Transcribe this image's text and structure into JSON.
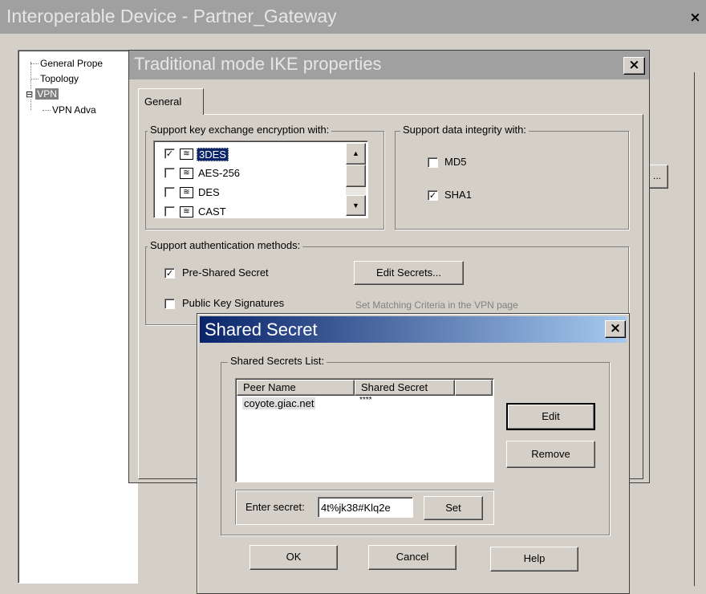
{
  "main_window": {
    "title": "Interoperable Device - Partner_Gateway",
    "tree": [
      {
        "label": "General Prope",
        "level": 0
      },
      {
        "label": "Topology",
        "level": 0
      },
      {
        "label": "VPN",
        "level": 0,
        "expander": "⊟",
        "selected": true
      },
      {
        "label": "VPN Adva",
        "level": 1
      }
    ],
    "partial_button_label": "..."
  },
  "ike_dialog": {
    "title": "Traditional mode IKE properties",
    "tab_label": "General",
    "encryption_group_label": "Support key exchange encryption with:",
    "encryption_items": [
      {
        "label": "3DES",
        "checked": true,
        "selected": true
      },
      {
        "label": "AES-256",
        "checked": false
      },
      {
        "label": "DES",
        "checked": false
      },
      {
        "label": "CAST",
        "checked": false
      }
    ],
    "integrity_group_label": "Support data integrity with:",
    "integrity_items": [
      {
        "label": "MD5",
        "checked": false
      },
      {
        "label": "SHA1",
        "checked": true
      }
    ],
    "auth_group_label": "Support authentication methods:",
    "pre_shared": {
      "label": "Pre-Shared Secret",
      "checked": true
    },
    "public_key": {
      "label": "Public Key Signatures",
      "checked": false
    },
    "edit_secrets_label": "Edit Secrets...",
    "matching_criteria_note": "Set Matching Criteria in the VPN page"
  },
  "secret_dialog": {
    "title": "Shared Secret",
    "list_group_label": "Shared Secrets List:",
    "columns": [
      "Peer Name",
      "Shared Secret"
    ],
    "rows": [
      {
        "peer": "coyote.giac.net",
        "secret": "****"
      }
    ],
    "edit_label": "Edit",
    "remove_label": "Remove",
    "enter_secret_label": "Enter secret:",
    "enter_secret_value": "4t%jk38#Klq2e",
    "set_label": "Set",
    "ok_label": "OK",
    "cancel_label": "Cancel",
    "help_label": "Help"
  },
  "colors": {
    "title_active": "#0a246a",
    "title_active_end": "#a6caf0",
    "title_inactive": "#a0a0a0",
    "face": "#d4d0c8",
    "selection": "#0a246a"
  }
}
